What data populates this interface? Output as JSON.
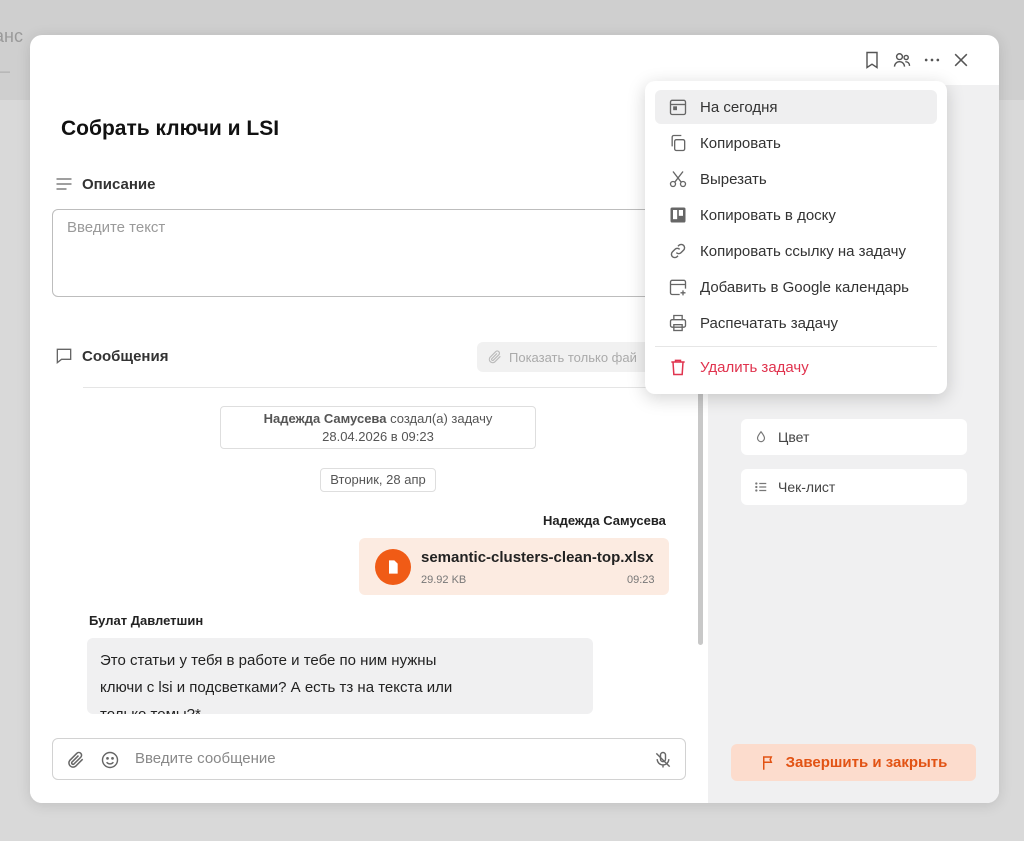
{
  "task": {
    "title": "Собрать ключи и LSI"
  },
  "description": {
    "label": "Описание",
    "placeholder": "Введите текст"
  },
  "messages": {
    "label": "Сообщения",
    "files_only_label": "Показать только фай",
    "system": {
      "author": "Надежда Самусева",
      "action": " создал(а) задачу",
      "datetime": "28.04.2026 в 09:23"
    },
    "date_divider": "Вторник, 28 апр",
    "file_message": {
      "sender": "Надежда Самусева",
      "file_name": "semantic-clusters-clean-top.xlsx",
      "file_size": "29.92 KB",
      "time": "09:23"
    },
    "text_message": {
      "sender": "Булат Давлетшин",
      "text": "Это статьи у тебя в работе и тебе по ним нужны ключи с lsi и подсветками? А есть тз на текста или только темы?*"
    }
  },
  "composer": {
    "placeholder": "Введите сообщение"
  },
  "sidebar": {
    "color_label": "Цвет",
    "checklist_label": "Чек-лист",
    "finish_label": "Завершить и закрыть"
  },
  "context_menu": {
    "items": [
      {
        "label": "На сегодня",
        "icon": "calendar-today-icon"
      },
      {
        "label": "Копировать",
        "icon": "copy-icon"
      },
      {
        "label": "Вырезать",
        "icon": "scissors-icon"
      },
      {
        "label": "Копировать в доску",
        "icon": "board-icon"
      },
      {
        "label": "Копировать ссылку на задачу",
        "icon": "link-icon"
      },
      {
        "label": "Добавить в Google календарь",
        "icon": "calendar-add-icon"
      },
      {
        "label": "Распечатать задачу",
        "icon": "printer-icon"
      }
    ],
    "delete_label": "Удалить задачу"
  },
  "colors": {
    "accent": "#f05b16",
    "danger": "#e0334e",
    "finish_bg": "#fcdccd",
    "file_msg_bg": "#fcebe1"
  }
}
